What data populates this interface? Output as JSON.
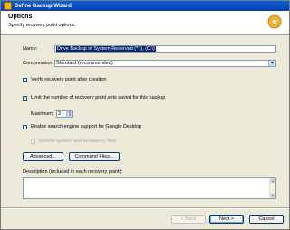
{
  "window": {
    "title": "Define Backup Wizard"
  },
  "header": {
    "title": "Options",
    "subtitle": "Specify recovery point options."
  },
  "form": {
    "name_label": "Name:",
    "name_value": "Drive Backup of System Reserved (*:\\), (C:\\)",
    "compression_label": "Compression:",
    "compression_value": "Standard (recommended)",
    "verify_label": "Verify recovery point after creation",
    "verify_checked": false,
    "limit_label": "Limit the number of recovery point sets saved for this backup",
    "limit_checked": true,
    "maximum_label": "Maximum:",
    "maximum_value": "3",
    "search_label": "Enable search engine support for Google Desktop",
    "search_checked": false,
    "include_label": "Include system and temporary files",
    "include_checked": false,
    "description_label": "Description (included in each recovery point):"
  },
  "buttons": {
    "advanced": "Advanced...",
    "command_files": "Command Files...",
    "back": "< Back",
    "next": "Next >",
    "cancel": "Cancel"
  },
  "icons": {
    "checkmark": "check-icon",
    "dropdown": "chevron-down-icon",
    "spin": "spin-arrows-icon"
  }
}
